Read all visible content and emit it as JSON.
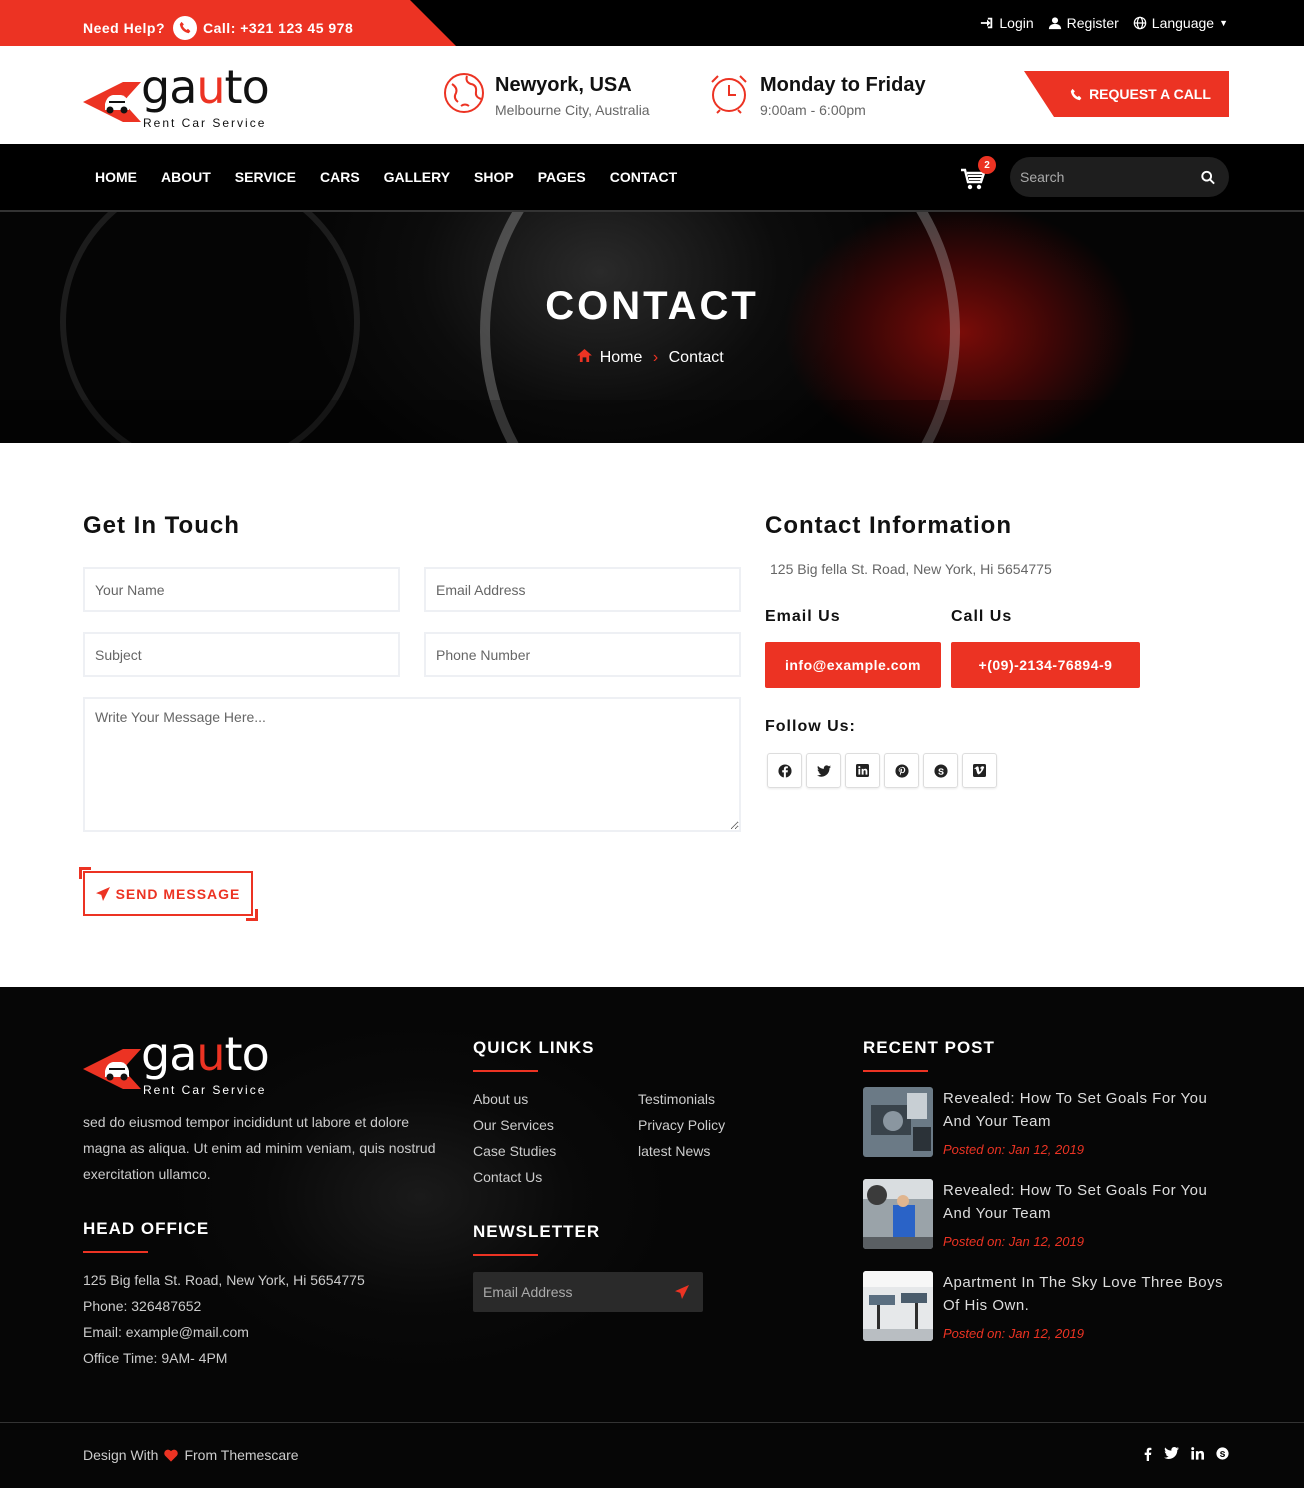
{
  "topbar": {
    "help_label": "Need Help?",
    "call_label": "Call: +321 123 45 978",
    "login": "Login",
    "register": "Register",
    "language": "Language"
  },
  "brand": {
    "word_a": "ga",
    "word_u": "u",
    "word_to": "to",
    "tagline": "Rent Car Service"
  },
  "header": {
    "location_title": "Newyork, USA",
    "location_sub": "Melbourne City, Australia",
    "hours_title": "Monday to Friday",
    "hours_sub": "9:00am - 6:00pm",
    "request_label": "REQUEST A CALL"
  },
  "nav": {
    "items": [
      "HOME",
      "ABOUT",
      "SERVICE",
      "CARS",
      "GALLERY",
      "SHOP",
      "PAGES",
      "CONTACT"
    ],
    "cart_count": "2",
    "search_placeholder": "Search"
  },
  "banner": {
    "title": "CONTACT",
    "crumb_home": "Home",
    "crumb_current": "Contact"
  },
  "form": {
    "title": "Get In Touch",
    "name_placeholder": "Your Name",
    "email_placeholder": "Email Address",
    "subject_placeholder": "Subject",
    "phone_placeholder": "Phone Number",
    "message_placeholder": "Write Your Message Here...",
    "send_label": "SEND MESSAGE"
  },
  "contact_info": {
    "title": "Contact Information",
    "address": "125 Big fella St. Road, New York, Hi 5654775",
    "email_label": "Email Us",
    "email_value": "info@example.com",
    "call_label": "Call Us",
    "call_value": "+(09)-2134-76894-9",
    "follow_label": "Follow Us:",
    "social_icons": [
      "facebook-icon",
      "twitter-icon",
      "linkedin-icon",
      "pinterest-icon",
      "skype-icon",
      "vimeo-icon"
    ]
  },
  "footer": {
    "about": "sed do eiusmod tempor incididunt ut labore et dolore magna as aliqua. Ut enim ad minim veniam, quis nostrud exercitation ullamco.",
    "head_office_title": "HEAD OFFICE",
    "office_lines": [
      "125 Big fella St. Road, New York, Hi 5654775",
      "Phone: 326487652",
      "Email: example@mail.com",
      "Office Time: 9AM- 4PM"
    ],
    "quick_links_title": "QUICK LINKS",
    "quick_links_col1": [
      "About us",
      "Our Services",
      "Case Studies",
      "Contact Us"
    ],
    "quick_links_col2": [
      "Testimonials",
      "Privacy Policy",
      "latest News"
    ],
    "newsletter_title": "NEWSLETTER",
    "newsletter_placeholder": "Email Address",
    "recent_post_title": "RECENT POST",
    "posts": [
      {
        "title": "Revealed: How To Set Goals For You And Your Team",
        "date": "Posted on: Jan 12, 2019"
      },
      {
        "title": "Revealed: How To Set Goals For You And Your Team",
        "date": "Posted on: Jan 12, 2019"
      },
      {
        "title": "Apartment In The Sky Love Three Boys Of His Own.",
        "date": "Posted on: Jan 12, 2019"
      }
    ],
    "credit_before": "Design With",
    "credit_after": "From Themescare"
  },
  "colors": {
    "accent": "#ec3323",
    "dark": "#000000"
  }
}
